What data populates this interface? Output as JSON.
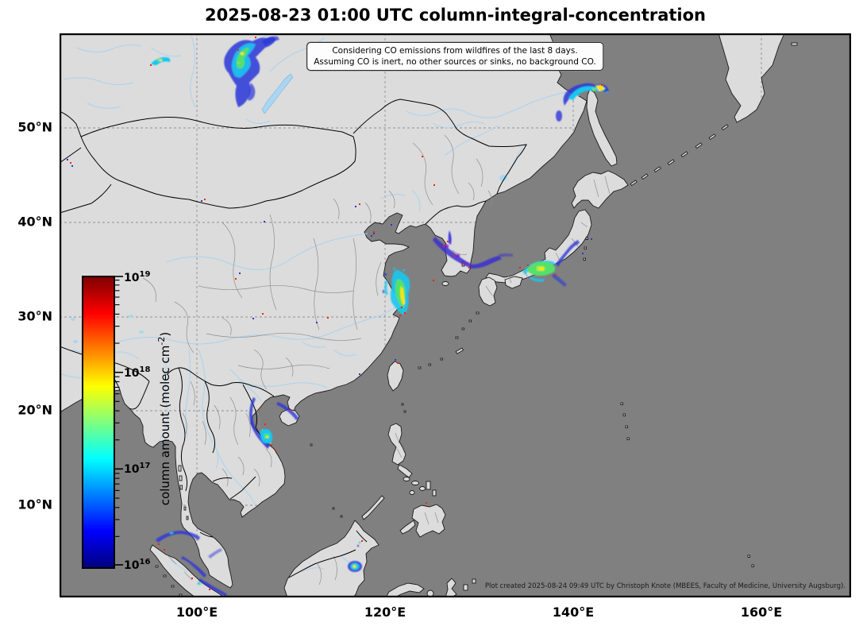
{
  "title": "2025-08-23 01:00 UTC column-integral-concentration",
  "annotation": {
    "line1": "Considering CO emissions from wildfires of the last 8 days.",
    "line2": "Assuming CO is inert, no other sources or sinks, no background CO."
  },
  "credit": "Plot created 2025-08-24 09:49 UTC by Christoph Knote (MBEES, Faculty of Medicine, University Augsburg).",
  "axes": {
    "lat_labels": [
      "50°N",
      "40°N",
      "30°N",
      "20°N",
      "10°N"
    ],
    "lon_labels": [
      "100°E",
      "120°E",
      "140°E",
      "160°E"
    ]
  },
  "colorbar": {
    "label_prefix": "column amount (molec cm",
    "label_exp": "-2",
    "label_suffix": ")",
    "ticks": [
      {
        "base": "10",
        "exp": "19"
      },
      {
        "base": "10",
        "exp": "18"
      },
      {
        "base": "10",
        "exp": "17"
      },
      {
        "base": "10",
        "exp": "16"
      }
    ],
    "scale": "logarithmic",
    "gradient_stops_bottom_to_top": [
      "#000080",
      "#0000ff",
      "#00ffff",
      "#ffff00",
      "#ff0000",
      "#800000"
    ]
  },
  "map": {
    "colors": {
      "ocean": "#808080",
      "land": "#dcdcdc",
      "river": "#a9d3f0",
      "lake": "#a9d7f2",
      "country_border": "#000000",
      "province_border": "#8f8f8f",
      "gridline": "#8c8c8c",
      "plume_blue": "#2a35d8",
      "plume_cyan": "#19c8f0",
      "plume_green": "#55e06a",
      "plume_yellow": "#ffe400",
      "plume_hotspot_red": "#ff2000"
    },
    "plume_regions": [
      "Siberia west of Lake Baikal",
      "Amur mouth near Sakhalin",
      "Yellow Sea / East China Sea off Shanghai",
      "South Korea coast",
      "Western Honshu (Japan)",
      "Vietnam coast and Gulf of Tonkin / Hainan",
      "Sumatra and Strait of Malacca",
      "Eastern Borneo"
    ]
  }
}
